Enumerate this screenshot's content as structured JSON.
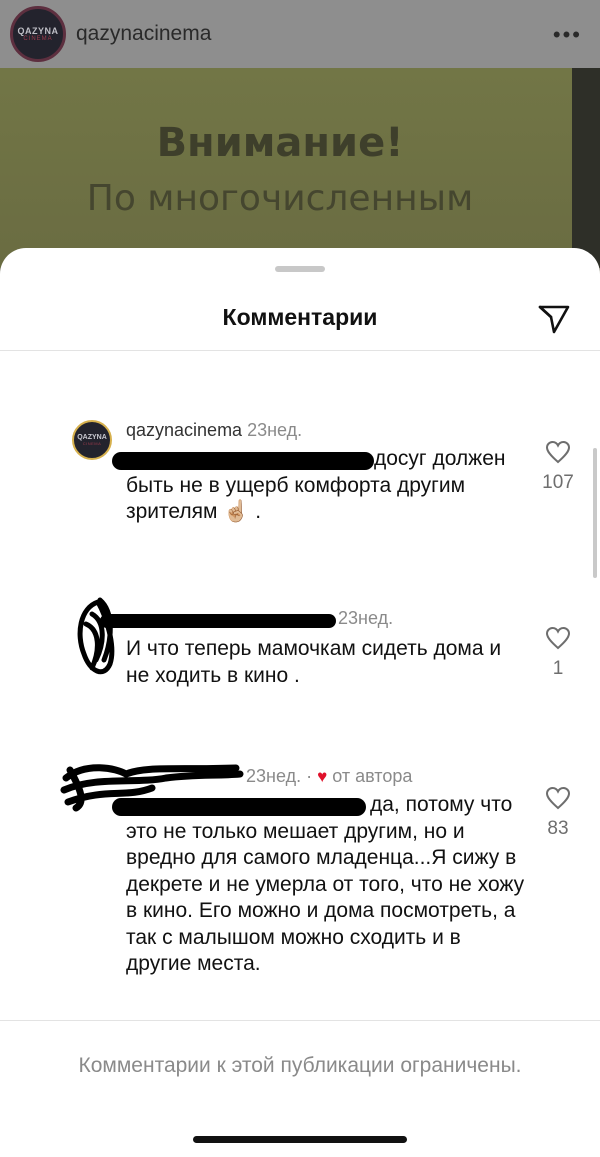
{
  "post": {
    "username": "qazynacinema",
    "avatar_logo": "QAZYNA",
    "avatar_logo_sub": "CINEMA",
    "more_icon": "more-horizontal-icon",
    "image_text_title": "Внимание!",
    "image_text_line": "По многочисленным"
  },
  "sheet": {
    "title": "Комментарии",
    "share_icon": "send-icon"
  },
  "comments": [
    {
      "username": "qazynacinema",
      "time": "23нед.",
      "text_after_mention": "досуг",
      "text_rest": "должен быть не в ущерб комфорта другим зрителям ☝🏼 .",
      "likes": "107"
    },
    {
      "username": "",
      "time": "23нед.",
      "text": "И что теперь мамочкам сидеть дома и не ходить в кино .",
      "likes": "1"
    },
    {
      "username": "",
      "time": "23нед.",
      "separator": "·",
      "author_heart": "♥",
      "author_label": "от автора",
      "text_after_mention": "да, потому",
      "text_rest": "что это не только мешает другим, но и вредно для самого младенца...Я сижу в декрете и не умерла от того, что не хожу в кино. Его можно и дома посмотреть, а так с малышом можно сходить и в другие места.",
      "likes": "83"
    }
  ],
  "footer": {
    "restricted_text": "Комментарии к этой публикации ограничены."
  },
  "colors": {
    "accent_red": "#e0112b",
    "mention_blue": "#1f4fa8",
    "muted_gray": "#8a8a8a"
  }
}
